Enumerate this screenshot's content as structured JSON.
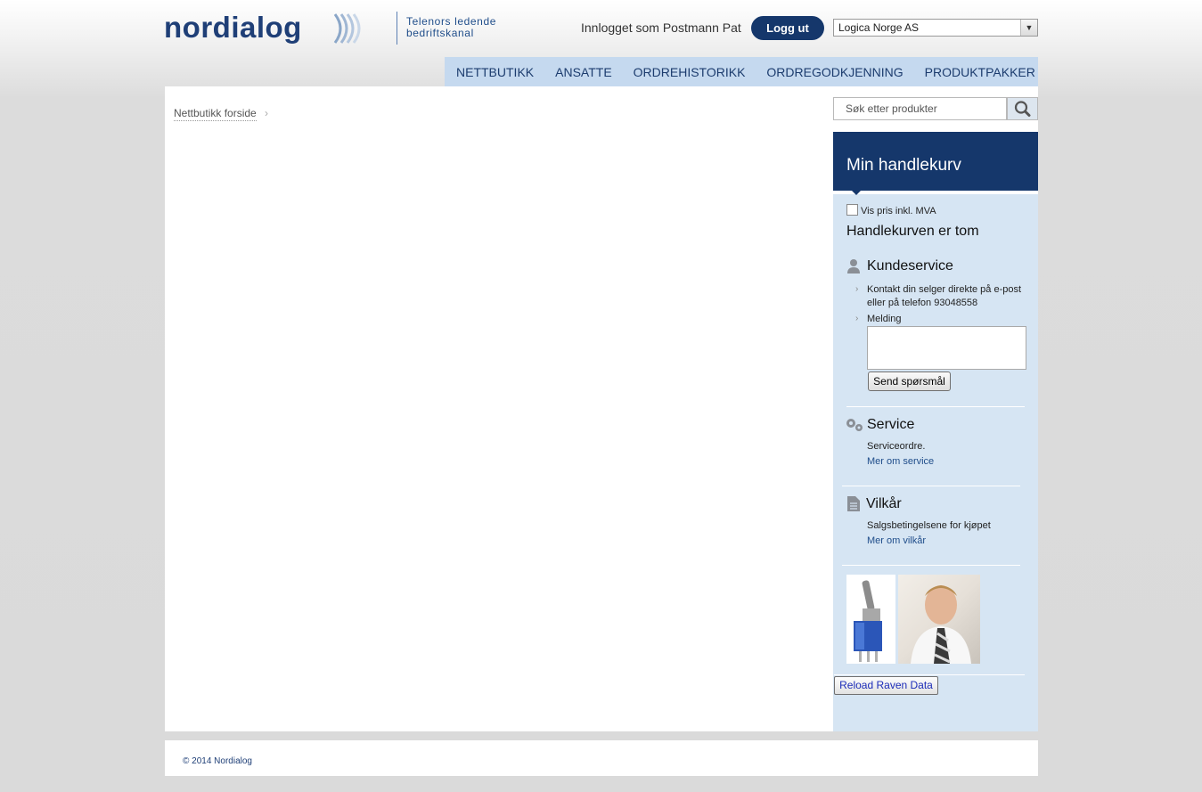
{
  "header": {
    "logo_text": "nordialog",
    "tagline_line1": "Telenors ledende",
    "tagline_line2": "bedriftskanal",
    "logged_in_text": "Innlogget som Postmann Pat",
    "logout_label": "Logg ut",
    "company_selected": "Logica Norge AS"
  },
  "nav": {
    "items": [
      "NETTBUTIKK",
      "ANSATTE",
      "ORDREHISTORIKK",
      "ORDREGODKJENNING",
      "PRODUKTPAKKER"
    ]
  },
  "main": {
    "breadcrumb": "Nettbutikk forside"
  },
  "sidebar": {
    "search_placeholder": "Søk etter produkter",
    "cart_title": "Min handlekurv",
    "vat_label": "Vis pris inkl. MVA",
    "cart_empty": "Handlekurven er tom",
    "customer_service": {
      "title": "Kundeservice",
      "contact_text": "Kontakt din selger direkte på e-post eller på telefon 93048558",
      "message_label": "Melding",
      "message_value": "",
      "send_label": "Send spørsmål"
    },
    "service": {
      "title": "Service",
      "text": "Serviceordre.",
      "link": "Mer om service"
    },
    "terms": {
      "title": "Vilkår",
      "text": "Salgsbetingelsene for kjøpet",
      "link": "Mer om vilkår"
    },
    "reload_label": "Reload Raven Data"
  },
  "footer": {
    "copyright": "© 2014 Nordialog"
  },
  "colors": {
    "brand_dark": "#15376b",
    "nav_bg": "#c5d9ef",
    "sidebar_bg": "#d6e5f3"
  }
}
